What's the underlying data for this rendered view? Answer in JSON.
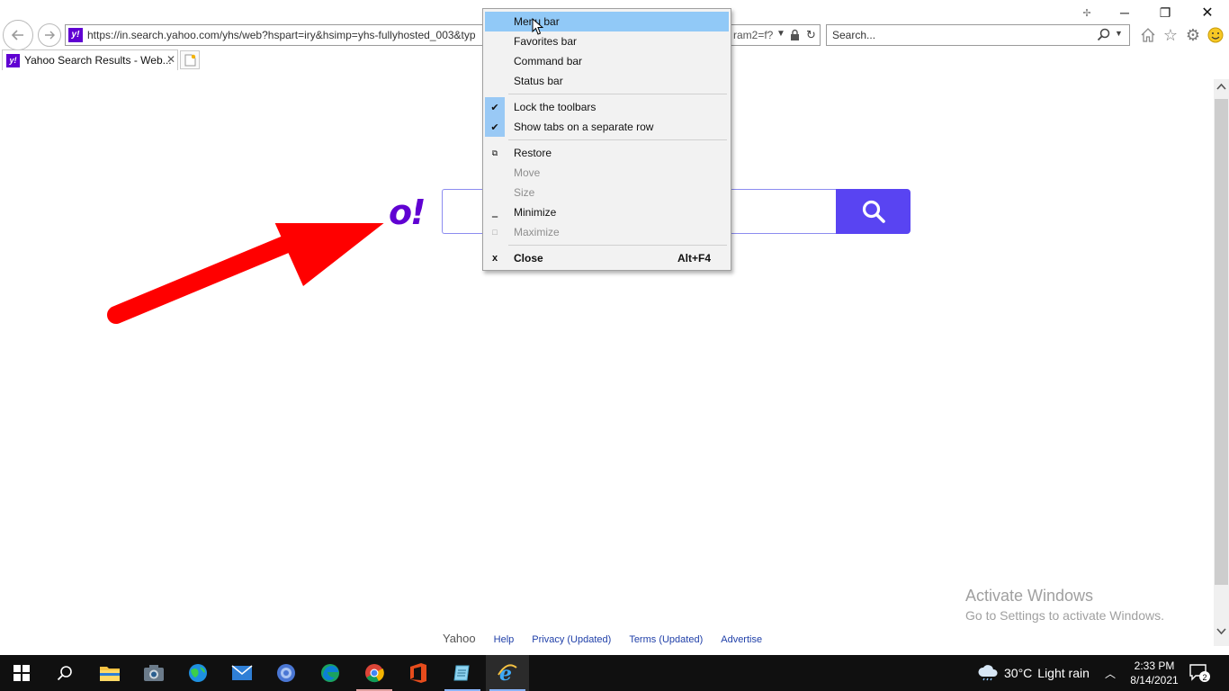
{
  "browser": {
    "address_url": "https://in.search.yahoo.com/yhs/web?hspart=iry&hsimp=yhs-fullyhosted_003&typ",
    "address_tail": "ram2=f?",
    "search_placeholder": "Search...",
    "tab_title": "Yahoo Search Results - Web..."
  },
  "page": {
    "logo_fragment": "o!",
    "footer": {
      "brand": "Yahoo",
      "links": [
        "Help",
        "Privacy (Updated)",
        "Terms (Updated)",
        "Advertise"
      ]
    },
    "activate_windows": {
      "title": "Activate Windows",
      "subtitle": "Go to Settings to activate Windows."
    }
  },
  "context_menu": {
    "items": [
      {
        "label": "Menu bar",
        "state": "highlighted"
      },
      {
        "label": "Favorites bar"
      },
      {
        "label": "Command bar"
      },
      {
        "label": "Status bar"
      },
      {
        "label": "Lock the toolbars",
        "checked": true
      },
      {
        "label": "Show tabs on a separate row",
        "checked": true
      },
      {
        "label": "Restore",
        "icon": "restore-icon"
      },
      {
        "label": "Move",
        "disabled": true
      },
      {
        "label": "Size",
        "disabled": true
      },
      {
        "label": "Minimize",
        "icon": "minimize-icon"
      },
      {
        "label": "Maximize",
        "icon": "maximize-icon",
        "disabled": true
      },
      {
        "label": "Close",
        "icon": "close-icon",
        "shortcut": "Alt+F4",
        "bold": true
      }
    ]
  },
  "taskbar": {
    "apps": [
      "start-icon",
      "search-icon",
      "file-explorer-icon",
      "camera-icon",
      "globe-icon",
      "mail-icon",
      "browser-icon",
      "edge-icon",
      "chrome-icon",
      "office-icon",
      "notepad-icon",
      "internet-explorer-icon"
    ],
    "weather": {
      "temp": "30°C",
      "condition": "Light rain"
    },
    "time": "2:33 PM",
    "date": "8/14/2021",
    "notifications": "2"
  },
  "colors": {
    "yahoo_purple": "#6001d2",
    "search_button": "#5944f2",
    "menu_highlight": "#91c9f7",
    "arrow_red": "#ff0000"
  }
}
